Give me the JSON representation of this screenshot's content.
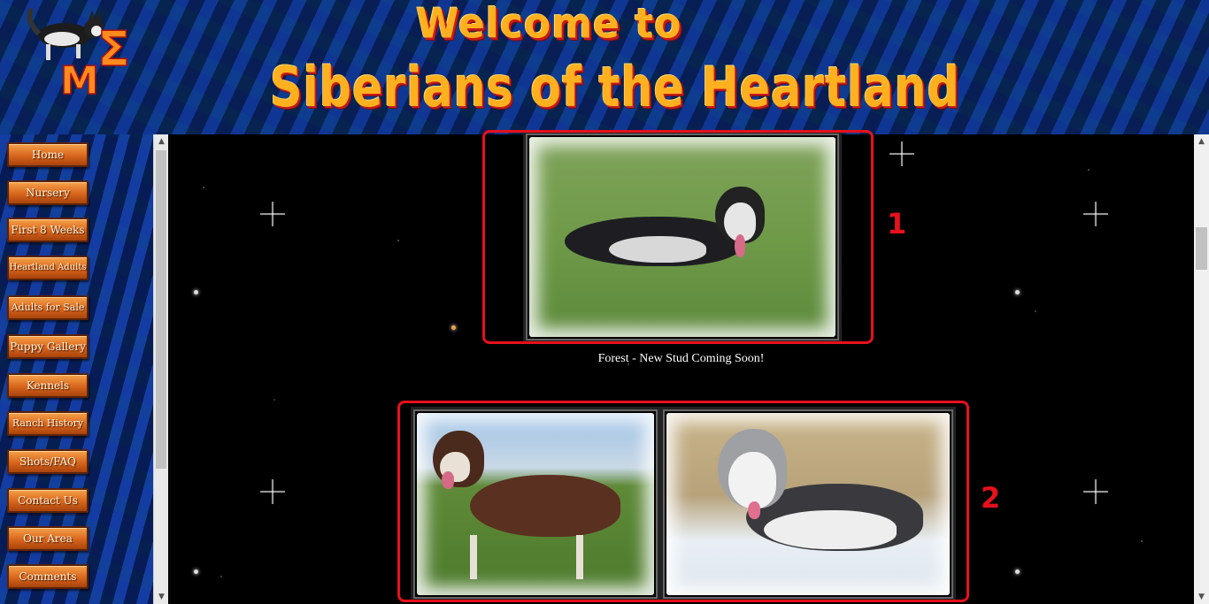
{
  "header": {
    "title_line1": "Welcome to",
    "title_line2": "Siberians of the Heartland"
  },
  "nav": {
    "items": [
      {
        "label": "Home"
      },
      {
        "label": "Nursery"
      },
      {
        "label": "First 8 Weeks"
      },
      {
        "label": "Heartland Adults"
      },
      {
        "label": "Adults for Sale"
      },
      {
        "label": "Puppy Gallery"
      },
      {
        "label": "Kennels"
      },
      {
        "label": "Ranch History"
      },
      {
        "label": "Shots/FAQ"
      },
      {
        "label": "Contact Us"
      },
      {
        "label": "Our Area"
      },
      {
        "label": "Comments"
      }
    ]
  },
  "main": {
    "caption": "Forest - New Stud Coming Soon!",
    "annotations": [
      "1",
      "2"
    ]
  },
  "colors": {
    "title": "#ffb01f",
    "button": "#d8651c",
    "highlight": "#e8101c",
    "background": "#000000"
  },
  "icons": [
    "husky-logo-icon",
    "scroll-up-icon",
    "scroll-down-icon"
  ]
}
